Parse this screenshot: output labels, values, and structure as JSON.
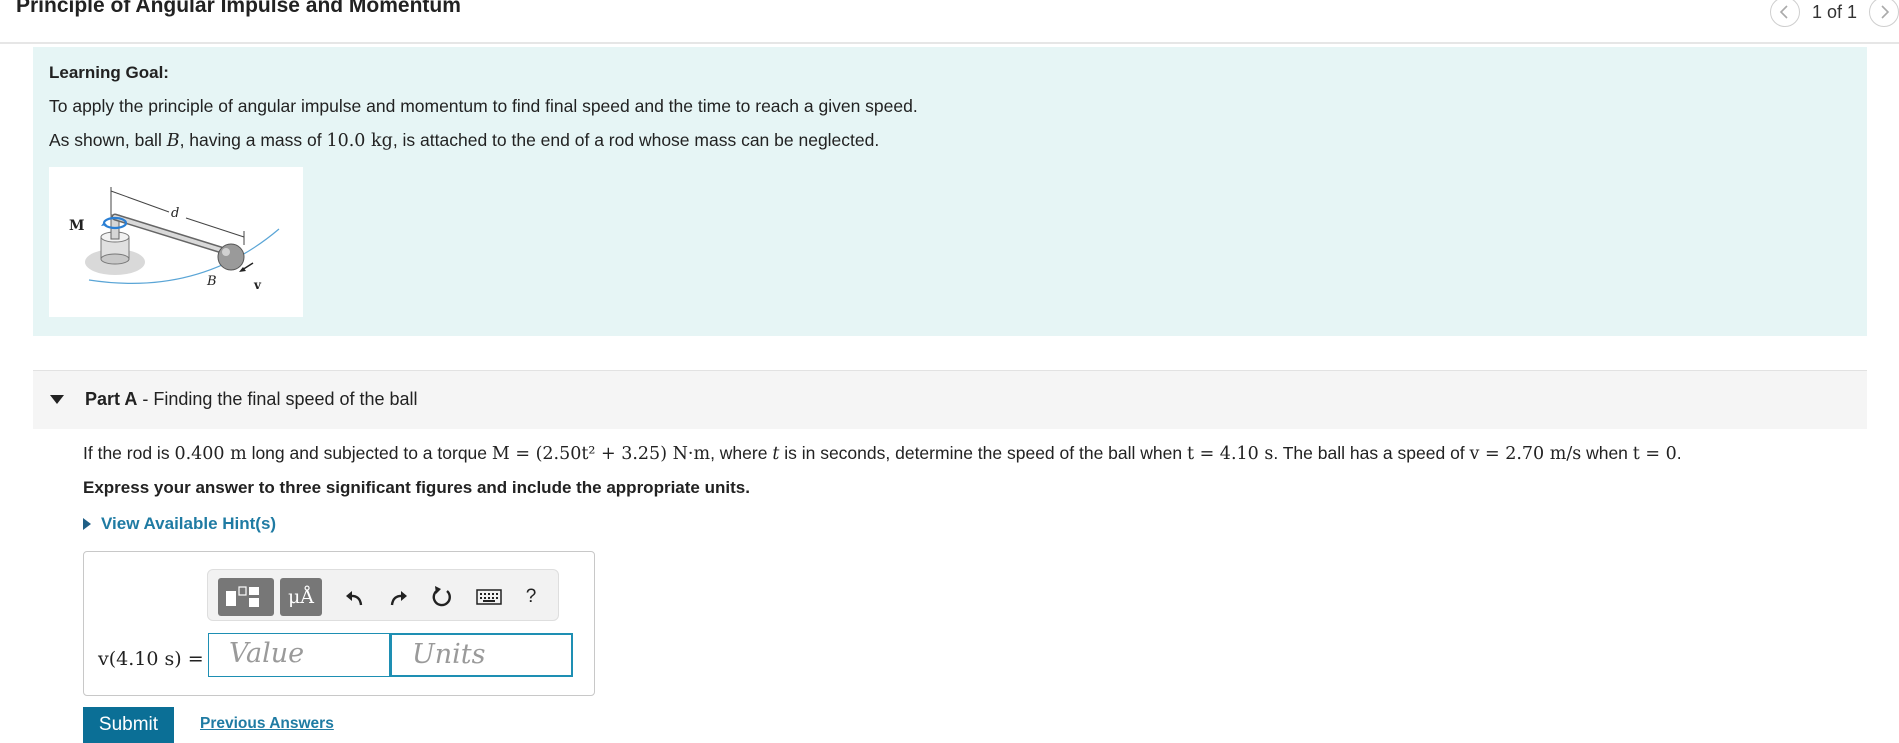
{
  "header": {
    "title": "Principle of Angular Impulse and Momentum",
    "pager": "1 of 1",
    "prev_icon": "chevron-left-icon",
    "next_icon": "chevron-right-icon"
  },
  "goal": {
    "label": "Learning Goal:",
    "line1": "To apply the principle of angular impulse and momentum to find final speed and the time to reach a given speed.",
    "line2_pre": "As shown, ball ",
    "line2_ball": "B",
    "line2_mid": ", having a mass of ",
    "line2_mass": "10.0 kg",
    "line2_post": ", is attached to the end of a rod whose mass can be neglected.",
    "figure": {
      "label_M": "M",
      "label_d": "d",
      "label_B": "B",
      "label_v": "v"
    }
  },
  "partA": {
    "prefix": "Part A",
    "separator": " - ",
    "title": "Finding the final speed of the ball",
    "question": {
      "t1": "If the rod is ",
      "m1": "0.400 m",
      "t2": " long and subjected to a torque ",
      "m2": "M = (2.50t² + 3.25) N·m",
      "t3": ", where ",
      "m3": "t",
      "t4": " is in seconds, determine the speed of the ball when ",
      "m4": "t = 4.10 s",
      "t5": ". The ball has a speed of ",
      "m5": "v = 2.70 m/s",
      "t6": " when ",
      "m6": "t = 0",
      "t7": "."
    },
    "instruction": "Express your answer to three significant figures and include the appropriate units.",
    "hints_label": "View Available Hint(s)",
    "toolbar": {
      "units_label": "μÅ",
      "help_label": "?",
      "icons": [
        "templates-icon",
        "units-icon",
        "undo-icon",
        "redo-icon",
        "reset-icon",
        "keyboard-icon",
        "help-icon"
      ]
    },
    "answer_label": "v(4.10 s) =",
    "value_placeholder": "Value",
    "units_placeholder": "Units",
    "submit_label": "Submit",
    "previous_answers_label": "Previous Answers"
  },
  "colors": {
    "goal_background": "#e6f5f5",
    "accent": "#1f7ba3",
    "submit_background": "#0b6f96",
    "input_border": "#1e8fb3"
  }
}
